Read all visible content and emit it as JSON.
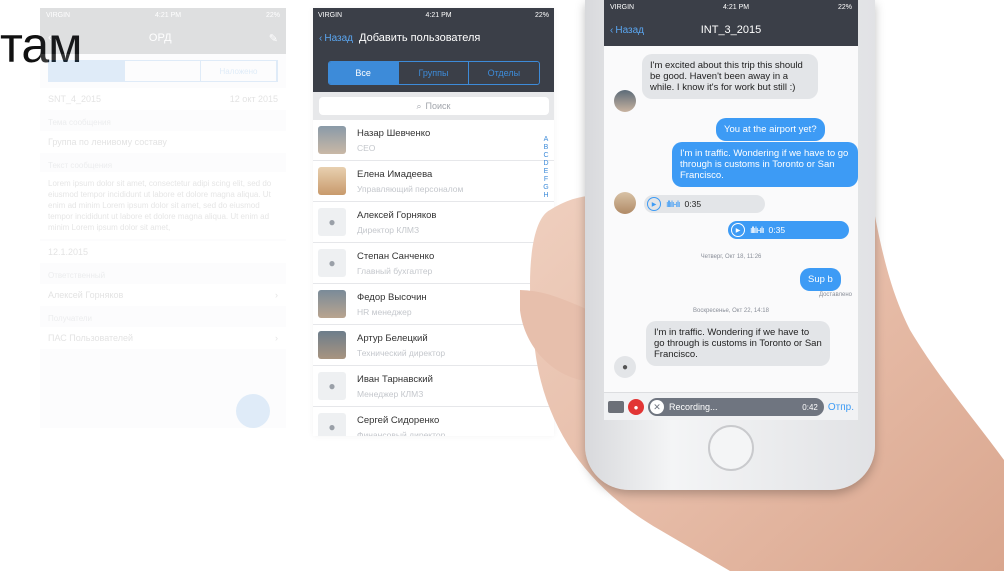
{
  "heading": {
    "text": "там"
  },
  "ghost": {
    "status_carrier": "VIRGIN",
    "status_time": "4:21 PM",
    "status_battery": "22%",
    "nav_title": "ОРД",
    "tabs": [
      "",
      "",
      "Наложено"
    ],
    "rows": [
      {
        "label": "SNT_4_2015",
        "value": "12 окт 2015"
      }
    ],
    "section1": "Тема сообщения",
    "field1": "Группа по ленивому составу",
    "section2": "Текст сообщения",
    "body": "Lorem ipsum dolor sit amet, consectetur adipi scing elit, sed do eiusmod tempor incididunt ut labore et dolore magna aliqua. Ut enim ad minim Lorem ipsum dolor sit amet, sed do eiusmod tempor incididunt ut labore et dolore magna aliqua. Ut enim ad minim Lorem ipsum dolor sit amet,",
    "date_row": "12.1.2015",
    "section3": "Ответственный",
    "person": "Алексей Горняков",
    "section4": "Получатели",
    "recipients": "ПАС Пользователей"
  },
  "mid": {
    "status_carrier": "VIRGIN",
    "status_time": "4:21 PM",
    "status_battery": "22%",
    "back_label": "Назад",
    "title": "Добавить пользователя",
    "tabs": [
      {
        "label": "Все",
        "active": true
      },
      {
        "label": "Группы",
        "active": false
      },
      {
        "label": "Отделы",
        "active": false
      }
    ],
    "search_placeholder": "Поиск",
    "contacts": [
      {
        "name": "Назар Шевченко",
        "role": "CEO",
        "avatar": "photo"
      },
      {
        "name": "Елена Имадеева",
        "role": "Управляющий персоналом",
        "avatar": "photo"
      },
      {
        "name": "Алексей Горняков",
        "role": "Директор КЛМЗ",
        "avatar": "placeholder"
      },
      {
        "name": "Степан Санченко",
        "role": "Главный бухгалтер",
        "avatar": "placeholder"
      },
      {
        "name": "Федор Высочин",
        "role": "HR менеджер",
        "avatar": "photo"
      },
      {
        "name": "Артур Белецкий",
        "role": "Технический директор",
        "avatar": "photo"
      },
      {
        "name": "Иван Тарнавский",
        "role": "Менеджер КЛМЗ",
        "avatar": "placeholder"
      },
      {
        "name": "Сергей Сидоренко",
        "role": "Финансовый директор",
        "avatar": "placeholder"
      }
    ],
    "alphabet": [
      "A",
      "B",
      "C",
      "D",
      "E",
      "F",
      "G",
      "H",
      "",
      "",
      "",
      "",
      "",
      "",
      "",
      "N",
      "O",
      "P",
      "",
      "",
      "",
      "",
      "",
      "",
      "",
      "W",
      "X",
      "Y",
      "Z"
    ]
  },
  "phone": {
    "status_carrier": "VIRGIN",
    "status_time": "4:21 PM",
    "status_battery": "22%",
    "back_label": "Назад",
    "title": "INT_3_2015",
    "messages": {
      "m1": "I'm excited about this trip this should be good. Haven't been away in a while. I know it's for work but still :)",
      "m2": "You at the airport yet?",
      "m3": "I'm in traffic. Wondering if we have to go through is customs in Toronto or San Francisco.",
      "v1": "0:35",
      "v2": "0:35",
      "sep1": "Четверг, Окт 18, 11:26",
      "m4": "Sup b",
      "delivered": "Доставлено",
      "sep2": "Воскресенье, Окт 22, 14:18",
      "m5": "I'm in traffic. Wondering if we have to go through is customs in Toronto or San Francisco."
    },
    "composer": {
      "recording": "Recording...",
      "time": "0:42",
      "send": "Отпр."
    }
  },
  "colors": {
    "navbar": "#3b3f48",
    "accent": "#3d9bf5",
    "incoming": "#e3e5e8",
    "record": "#e23535"
  }
}
